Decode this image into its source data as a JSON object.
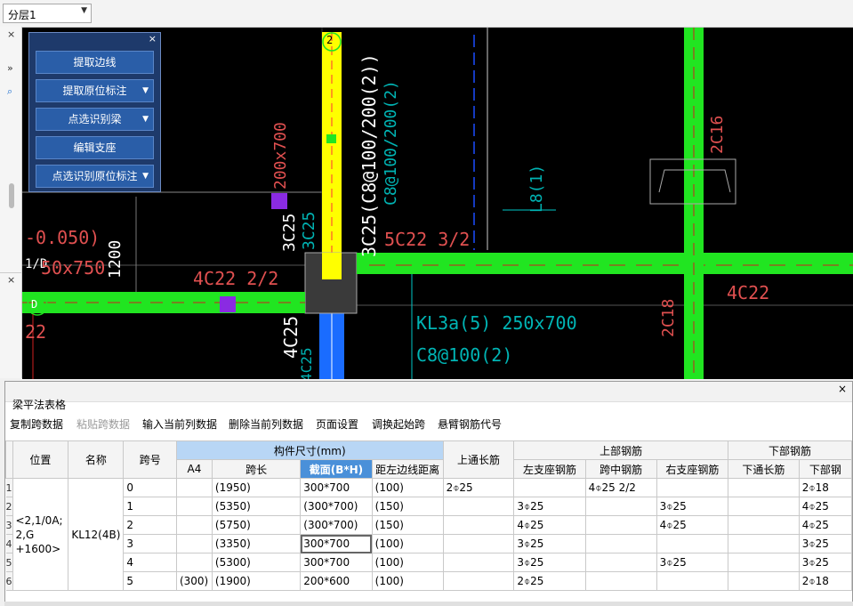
{
  "topbar": {
    "layer_value": "分层1"
  },
  "panel": {
    "buttons": [
      "提取边线",
      "提取原位标注",
      "点选识别梁",
      "编辑支座",
      "点选识别原位标注"
    ]
  },
  "cad": {
    "labels": {
      "axis2": "2",
      "axisD": "D",
      "axis1D": "1/D",
      "b1": "3C25(C8@100/200(2))",
      "b2": "C8@100/200(2)",
      "b3": "200x700",
      "b4": "3C25",
      "b5": "3C25",
      "b6": "5C22 3/2",
      "b7": "L8(1)",
      "b8": "2C16",
      "b9": "4C22 2/2",
      "b10": "4C25",
      "b11": "4C25",
      "b12": "KL3a(5) 250x700",
      "b13": "C8@100(2)",
      "b14": "2C18",
      "b15": "4C22",
      "b16": "-0.050)",
      "b17": "50x750",
      "b18": "22",
      "b19": "1200"
    },
    "colors": {
      "green": "#21e521",
      "yellow": "#ffff00",
      "blue": "#1a6cff",
      "purple": "#8a2be2"
    }
  },
  "table": {
    "title": "梁平法表格",
    "toolbar": [
      "复制跨数据",
      "粘贴跨数据",
      "输入当前列数据",
      "删除当前列数据",
      "页面设置",
      "调换起始跨",
      "悬臂钢筋代号"
    ],
    "headers": {
      "position": "位置",
      "name": "名称",
      "span_no": "跨号",
      "dims": "构件尺寸(mm)",
      "a4": "A4",
      "span_len": "跨长",
      "section": "截面(B*H)",
      "edge_dist": "距左边线距离",
      "top_through": "上通长筋",
      "top_group": "上部钢筋",
      "left_support": "左支座钢筋",
      "mid_span": "跨中钢筋",
      "right_support": "右支座钢筋",
      "bottom_group": "下部钢筋",
      "bottom_through": "下通长筋",
      "bottom_rebar": "下部钢"
    },
    "position_value": "<2,1/0A;\n2,G\n+1600>",
    "name_value": "KL12(4B)",
    "rows": [
      {
        "rn": "1",
        "span": "0",
        "a4": "",
        "len": "(1950)",
        "sec": "300*700",
        "dist": "(100)",
        "top": "2⌽25",
        "left": "",
        "mid": "4⌽25 2/2",
        "right": "",
        "bthr": "",
        "bot": "2⌽18"
      },
      {
        "rn": "2",
        "span": "1",
        "a4": "",
        "len": "(5350)",
        "sec": "(300*700)",
        "dist": "(150)",
        "top": "",
        "left": "3⌽25",
        "mid": "",
        "right": "3⌽25",
        "bthr": "",
        "bot": "4⌽25"
      },
      {
        "rn": "3",
        "span": "2",
        "a4": "",
        "len": "(5750)",
        "sec": "(300*700)",
        "dist": "(150)",
        "top": "",
        "left": "4⌽25",
        "mid": "",
        "right": "4⌽25",
        "bthr": "",
        "bot": "4⌽25"
      },
      {
        "rn": "4",
        "span": "3",
        "a4": "",
        "len": "(3350)",
        "sec": "300*700",
        "dist": "(100)",
        "top": "",
        "left": "3⌽25",
        "mid": "",
        "right": "",
        "bthr": "",
        "bot": "3⌽25"
      },
      {
        "rn": "5",
        "span": "4",
        "a4": "",
        "len": "(5300)",
        "sec": "300*700",
        "dist": "(100)",
        "top": "",
        "left": "3⌽25",
        "mid": "",
        "right": "3⌽25",
        "bthr": "",
        "bot": "3⌽25"
      },
      {
        "rn": "6",
        "span": "5",
        "a4": "(300)",
        "len": "(1900)",
        "sec": "200*600",
        "dist": "(100)",
        "top": "",
        "left": "2⌽25",
        "mid": "",
        "right": "",
        "bthr": "",
        "bot": "2⌽18"
      }
    ]
  }
}
